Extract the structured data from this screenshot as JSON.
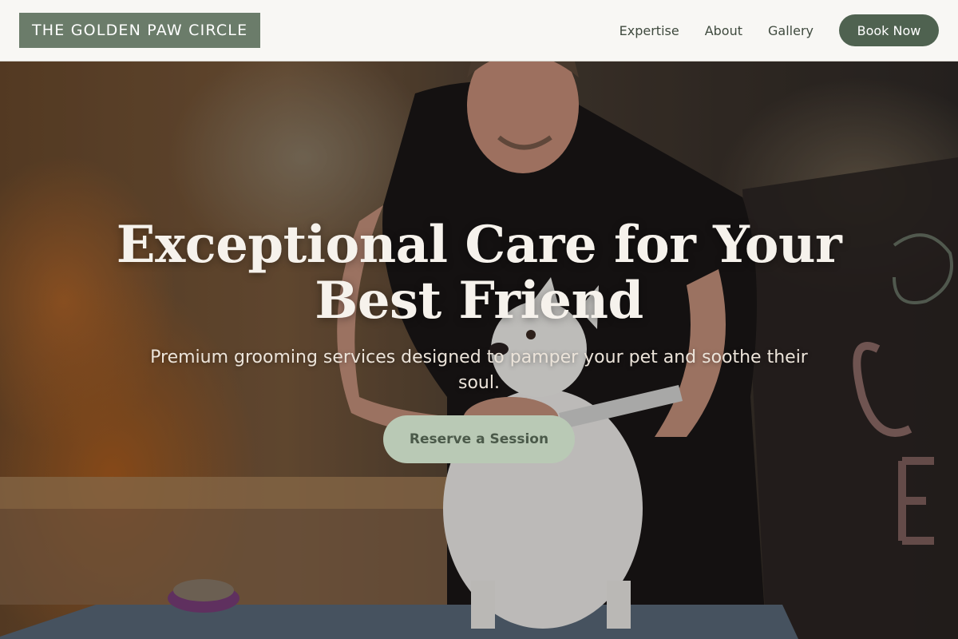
{
  "brand": {
    "name": "THE GOLDEN PAW CIRCLE"
  },
  "nav": {
    "items": [
      {
        "label": "Expertise"
      },
      {
        "label": "About"
      },
      {
        "label": "Gallery"
      }
    ],
    "cta_label": "Book Now"
  },
  "hero": {
    "title": "Exceptional Care for Your Best Friend",
    "subtitle": "Premium grooming services designed to pamper your pet and soothe their soul.",
    "cta_label": "Reserve a Session",
    "image_icon": "groomer-with-dog-photo"
  },
  "colors": {
    "header_bg": "#f8f7f4",
    "logo_bg": "#6b7c6a",
    "nav_text": "#3f4a3e",
    "nav_button": "#4f6250",
    "hero_button": "#b9c9b5",
    "hero_button_text": "#4b5a4a",
    "hero_text": "#f6f2ec"
  }
}
